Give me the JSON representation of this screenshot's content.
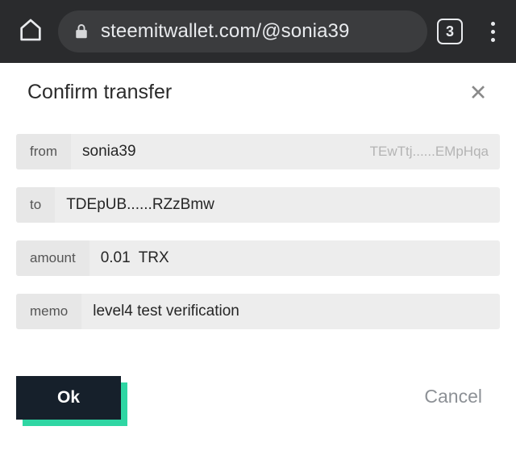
{
  "browser": {
    "home_icon": "home-icon",
    "lock_icon": "lock-icon",
    "url": "steemitwallet.com/@sonia39",
    "tab_count": "3",
    "menu_icon": "overflow-menu-icon"
  },
  "dialog": {
    "title": "Confirm transfer",
    "close_label": "✕",
    "fields": [
      {
        "label": "from",
        "value": "sonia39",
        "hint": "TEwTtj......EMpHqa"
      },
      {
        "label": "to",
        "value": "TDEpUB......RZzBmw",
        "hint": ""
      },
      {
        "label": "amount",
        "value": "0.01",
        "unit": "TRX",
        "hint": ""
      },
      {
        "label": "memo",
        "value": "level4 test verification",
        "hint": ""
      }
    ],
    "ok_label": "Ok",
    "cancel_label": "Cancel",
    "accent_color": "#2fd6a3",
    "ok_background": "#16202b"
  }
}
